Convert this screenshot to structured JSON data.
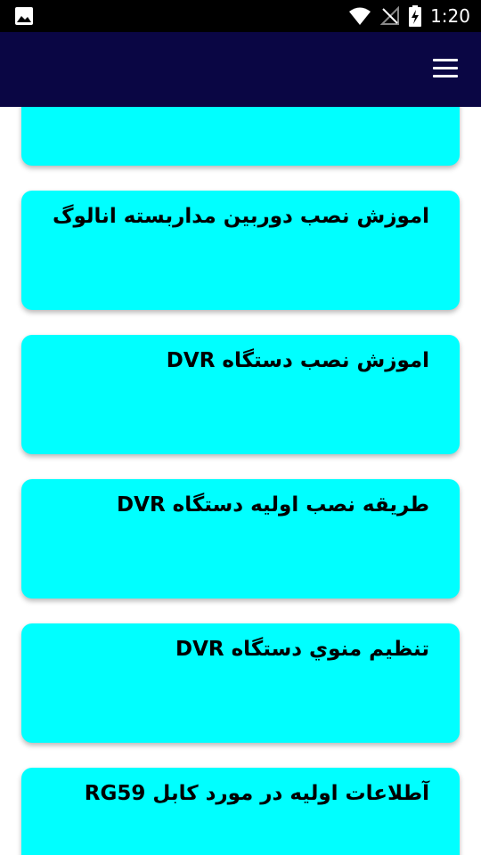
{
  "status_bar": {
    "time": "1:20",
    "icons": [
      "image-icon",
      "wifi-icon",
      "no-signal-icon",
      "battery-charging-icon"
    ]
  },
  "app_bar": {
    "menu_icon": "hamburger-menu-icon",
    "color": "#0a0644"
  },
  "colors": {
    "card": "#00ffff",
    "text": "#000000"
  },
  "items": [
    {
      "title": ""
    },
    {
      "title": "اموزش نصب دوربین مداربسته انالوگ"
    },
    {
      "title": "اموزش نصب دستگاه DVR"
    },
    {
      "title": "طریقه نصب اولیه دستگاه DVR"
    },
    {
      "title": "تنظیم منوي دستگاه DVR"
    },
    {
      "title": "آطلاعات اولیه در مورد کابل RG59"
    }
  ]
}
